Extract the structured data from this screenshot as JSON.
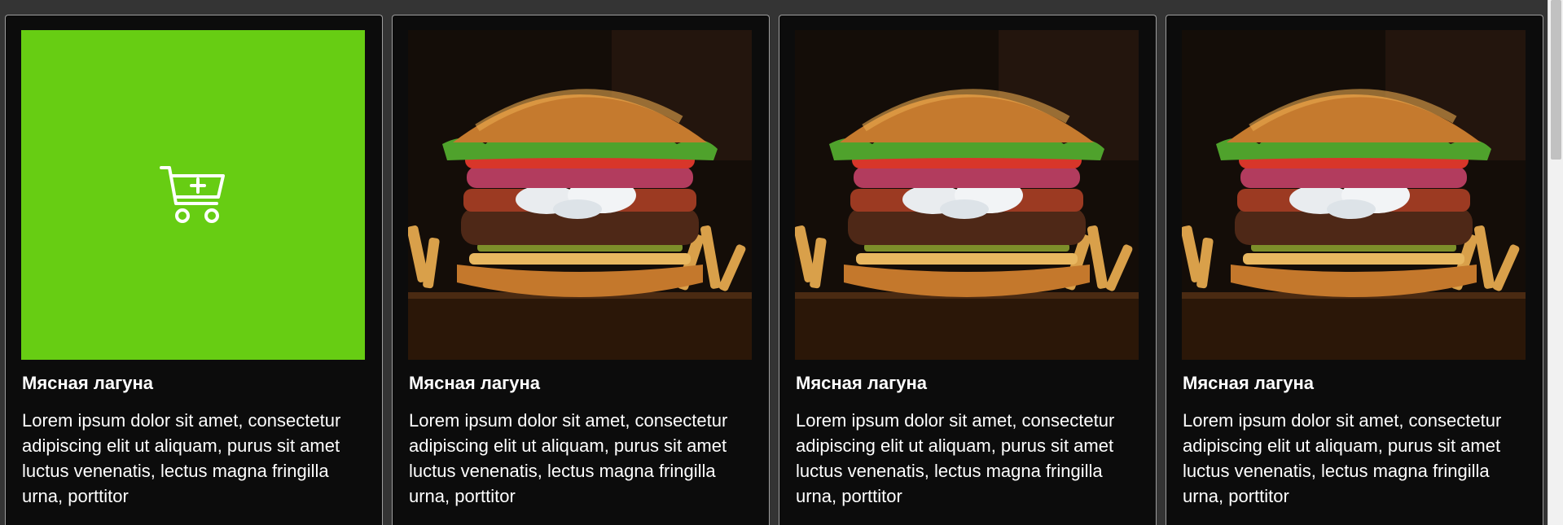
{
  "products": [
    {
      "title": "Мясная лагуна",
      "description": "Lorem ipsum dolor sit amet, consectetur adipiscing elit ut aliquam, purus sit amet luctus venenatis, lectus magna fringilla urna, porttitor",
      "image": "burger-photo",
      "hover_overlay": true,
      "overlay_icon": "cart-plus-icon",
      "overlay_color": "#67cd13"
    },
    {
      "title": "Мясная лагуна",
      "description": "Lorem ipsum dolor sit amet, consectetur adipiscing elit ut aliquam, purus sit amet luctus venenatis, lectus magna fringilla urna, porttitor",
      "image": "burger-photo",
      "hover_overlay": false
    },
    {
      "title": "Мясная лагуна",
      "description": "Lorem ipsum dolor sit amet, consectetur adipiscing elit ut aliquam, purus sit amet luctus venenatis, lectus magna fringilla urna, porttitor",
      "image": "burger-photo",
      "hover_overlay": false
    },
    {
      "title": "Мясная лагуна",
      "description": "Lorem ipsum dolor sit amet, consectetur adipiscing elit ut aliquam, purus sit amet luctus venenatis, lectus magna fringilla urna, porttitor",
      "image": "burger-photo",
      "hover_overlay": false
    }
  ],
  "colors": {
    "page_background": "#343434",
    "card_background": "#0c0c0c",
    "card_border": "#9d9d9d",
    "accent_green": "#67cd13",
    "text": "#ffffff"
  }
}
